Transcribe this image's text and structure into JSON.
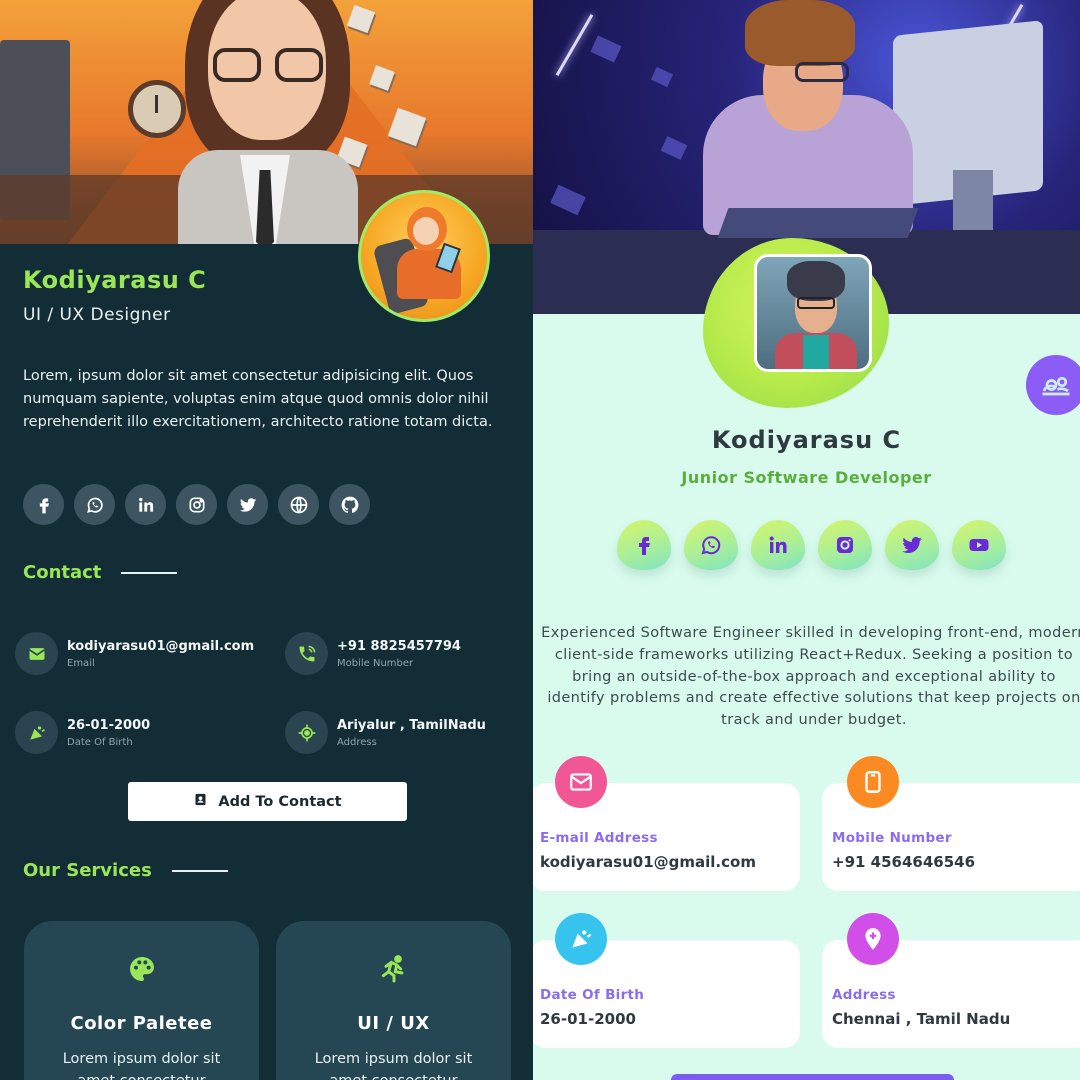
{
  "left_card": {
    "name": "Kodiyarasu C",
    "title": "UI / UX Designer",
    "bio": "Lorem, ipsum dolor sit amet consectetur adipisicing elit. Quos numquam sapiente, voluptas enim atque quod omnis dolor nihil reprehenderit illo exercitationem, architecto ratione totam dicta.",
    "social": [
      "facebook-icon",
      "whatsapp-icon",
      "linkedin-icon",
      "instagram-icon",
      "twitter-icon",
      "globe-icon",
      "github-icon"
    ],
    "contact_heading": "Contact",
    "contacts": [
      {
        "value": "kodiyarasu01@gmail.com",
        "label": "Email",
        "icon": "mail-icon"
      },
      {
        "value": "+91 8825457794",
        "label": "Mobile Number",
        "icon": "phone-icon"
      },
      {
        "value": "26-01-2000",
        "label": "Date Of Birth",
        "icon": "cake-icon"
      },
      {
        "value": "Ariyalur , TamilNadu",
        "label": "Address",
        "icon": "location-icon"
      }
    ],
    "add_button": "Add To Contact",
    "services_heading": "Our Services",
    "services": [
      {
        "title": "Color Paletee",
        "desc": "Lorem ipsum dolor sit amet consectetur",
        "icon": "palette-icon"
      },
      {
        "title": "UI / UX",
        "desc": "Lorem ipsum dolor sit amet consectetur",
        "icon": "runner-icon"
      }
    ],
    "accent": "#9ae657",
    "background": "#132d37"
  },
  "right_card": {
    "name": "Kodiyarasu C",
    "title": "Junior Software Developer",
    "social": [
      "facebook-icon",
      "whatsapp-icon",
      "linkedin-icon",
      "instagram-icon",
      "twitter-icon",
      "youtube-icon"
    ],
    "bio": "Experienced Software Engineer skilled in developing front-end, modern client-side frameworks utilizing React+Redux. Seeking a position to bring an outside-of-the-box approach and exceptional ability to identify problems and create effective solutions that keep projects on track and under budget.",
    "contacts": [
      {
        "label": "E-mail Address",
        "value": "kodiyarasu01@gmail.com",
        "icon": "mail-icon",
        "color": "#f25795"
      },
      {
        "label": "Mobile Number",
        "value": "+91 4564646546",
        "icon": "mobile-icon",
        "color": "#fb8a23"
      },
      {
        "label": "Date Of Birth",
        "value": "26-01-2000",
        "icon": "cake-icon",
        "color": "#36c4ee"
      },
      {
        "label": "Address",
        "value": "Chennai , Tamil Nadu",
        "icon": "location-icon",
        "color": "#d24ee8"
      }
    ],
    "accent": "#7b5cf0",
    "background": "#d8fbee"
  }
}
